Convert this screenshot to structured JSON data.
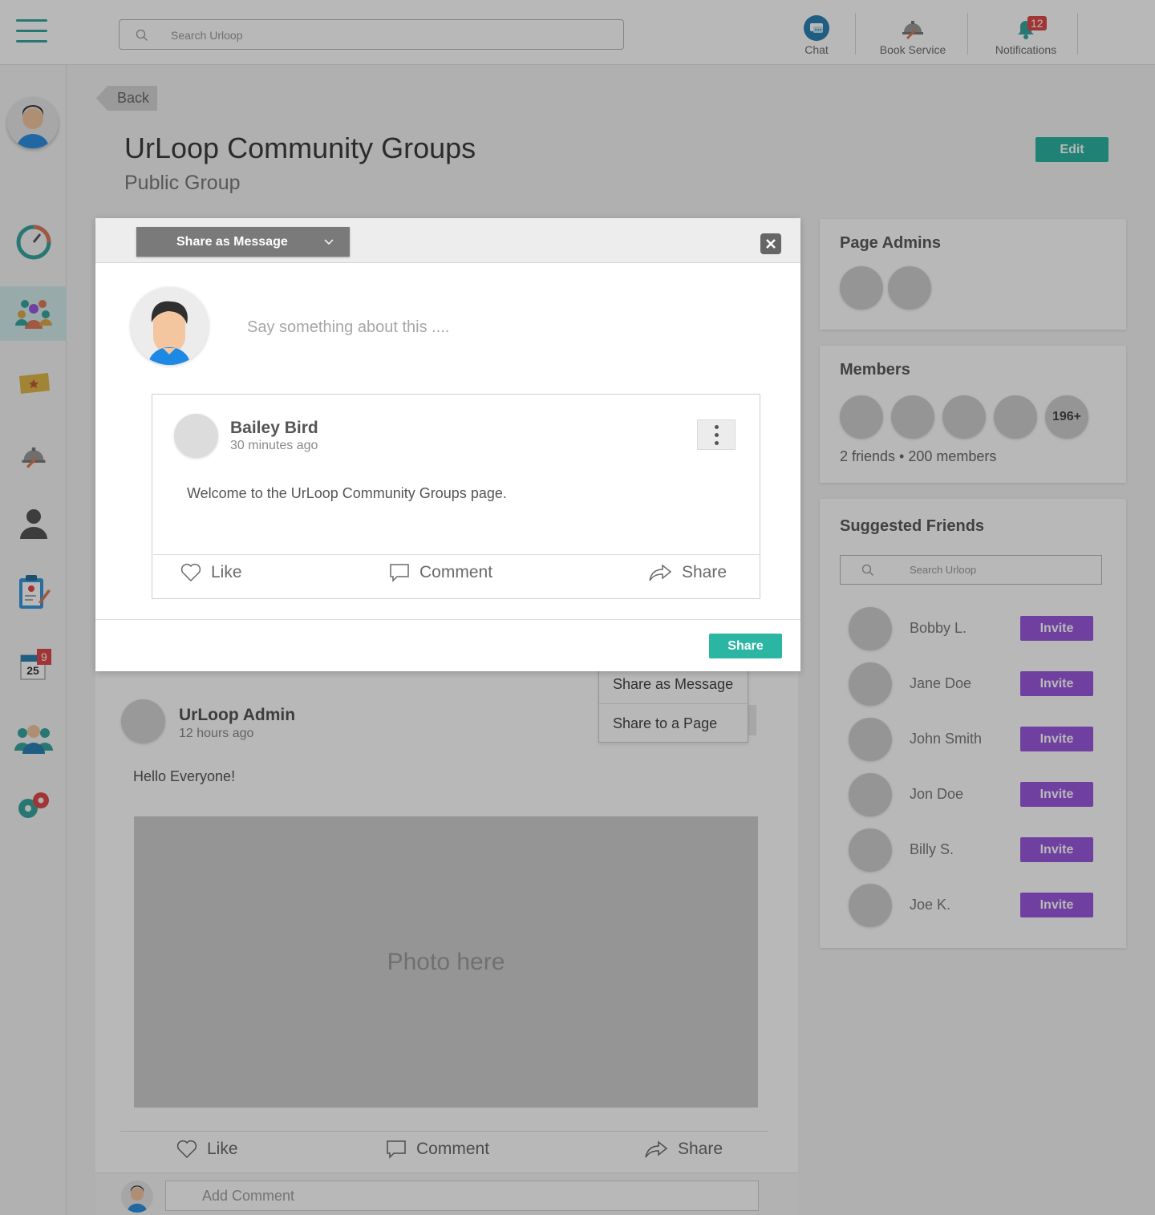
{
  "header": {
    "search_placeholder": "Search Urloop",
    "chat_label": "Chat",
    "book_service_label": "Book Service",
    "notifications_label": "Notifications",
    "notifications_count": "12"
  },
  "sidebar": {
    "calendar_badge": "9",
    "calendar_day": "25"
  },
  "page": {
    "back_label": "Back",
    "title": "UrLoop Community Groups",
    "subtitle": "Public Group",
    "edit_label": "Edit"
  },
  "page_admins": {
    "title": "Page Admins"
  },
  "members": {
    "title": "Members",
    "more_count": "196+",
    "meta": "2 friends • 200 members"
  },
  "suggested_friends": {
    "title": "Suggested Friends",
    "search_placeholder": "Search Urloop",
    "invite_label": "Invite",
    "people": [
      "Bobby L.",
      "Jane Doe",
      "John Smith",
      "Jon Doe",
      "Billy S.",
      "Joe K."
    ]
  },
  "feed_post": {
    "author": "UrLoop Admin",
    "time": "12 hours ago",
    "text": "Hello Everyone!",
    "photo_placeholder": "Photo here",
    "like_label": "Like",
    "comment_label": "Comment",
    "share_label": "Share",
    "add_comment_placeholder": "Add Comment"
  },
  "share_menu": {
    "items": [
      "Share as Message",
      "Share to a Page"
    ]
  },
  "modal": {
    "share_type": "Share as Message",
    "say_placeholder": "Say something about this ....",
    "inner_post": {
      "author": "Bailey Bird",
      "time": "30 minutes ago",
      "text": "Welcome to the UrLoop Community Groups page.",
      "like_label": "Like",
      "comment_label": "Comment",
      "share_label": "Share"
    },
    "share_button_label": "Share"
  },
  "colors": {
    "teal": "#2bb5a3",
    "purple": "#9b59e0",
    "badge_red": "#e04a4a"
  }
}
